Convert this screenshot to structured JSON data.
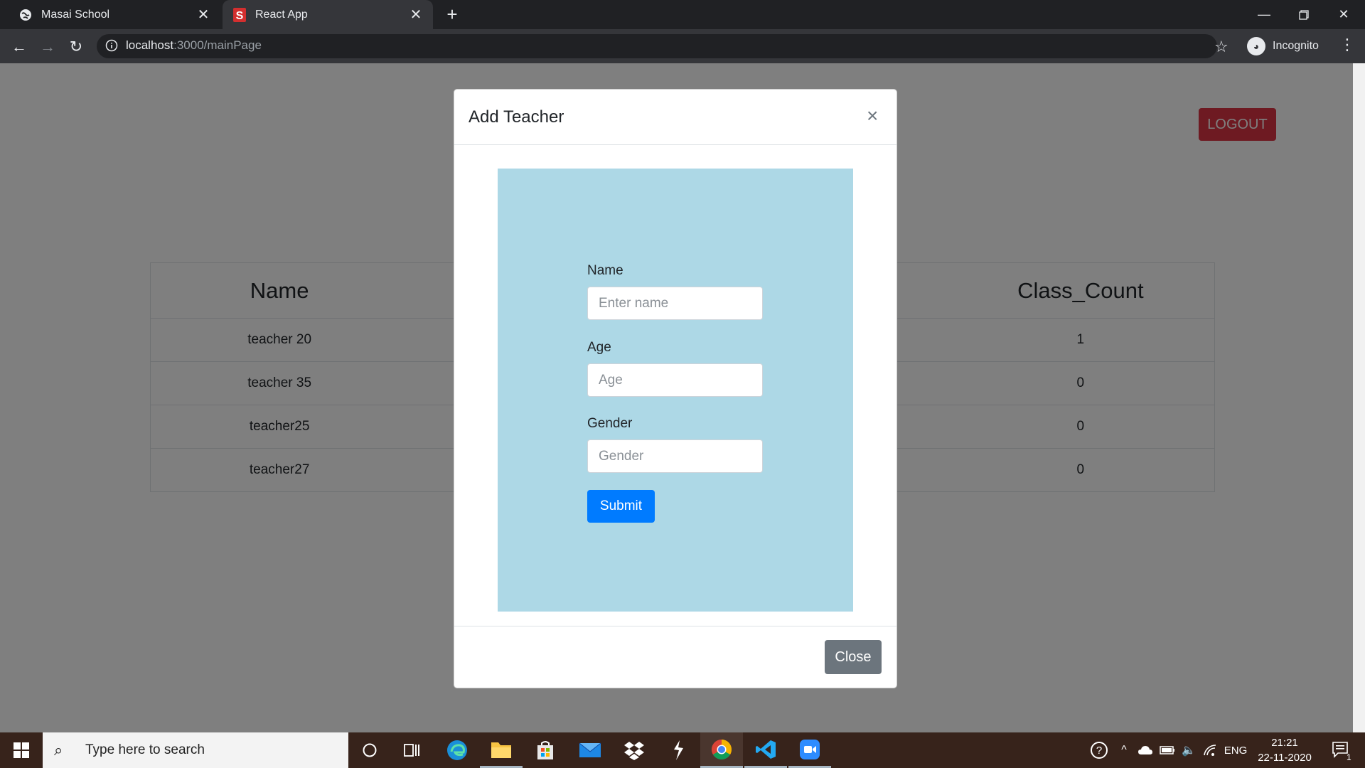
{
  "browser": {
    "tabs": [
      {
        "title": "Masai School",
        "icon": "globe-icon",
        "active": false
      },
      {
        "title": "React App",
        "icon": "s-logo-icon",
        "active": true
      }
    ],
    "url_host": "localhost",
    "url_path": ":3000/mainPage",
    "profile_label": "Incognito"
  },
  "page": {
    "logout_label": "LOGOUT",
    "table": {
      "headers": [
        "Name",
        "",
        "Class_Count"
      ],
      "rows": [
        {
          "name": "teacher 20",
          "class_count": "1"
        },
        {
          "name": "teacher 35",
          "class_count": "0"
        },
        {
          "name": "teacher25",
          "class_count": "0"
        },
        {
          "name": "teacher27",
          "class_count": "0"
        }
      ]
    }
  },
  "modal": {
    "title": "Add Teacher",
    "close_x": "×",
    "form": {
      "name_label": "Name",
      "name_placeholder": "Enter name",
      "age_label": "Age",
      "age_placeholder": "Age",
      "gender_label": "Gender",
      "gender_placeholder": "Gender",
      "submit_label": "Submit"
    },
    "close_label": "Close"
  },
  "taskbar": {
    "search_placeholder": "Type here to search",
    "apps": [
      "cortana-icon",
      "task-view-icon",
      "edge-icon",
      "file-explorer-icon",
      "store-icon",
      "mail-icon",
      "dropbox-icon",
      "app-icon",
      "chrome-icon",
      "vscode-icon",
      "zoom-icon"
    ],
    "language": "ENG",
    "time": "21:21",
    "date": "22-11-2020",
    "notification_count": "1"
  },
  "colors": {
    "logout": "#dc3545",
    "submit": "#007bff",
    "close": "#6c757d",
    "form_panel": "#add8e6"
  }
}
